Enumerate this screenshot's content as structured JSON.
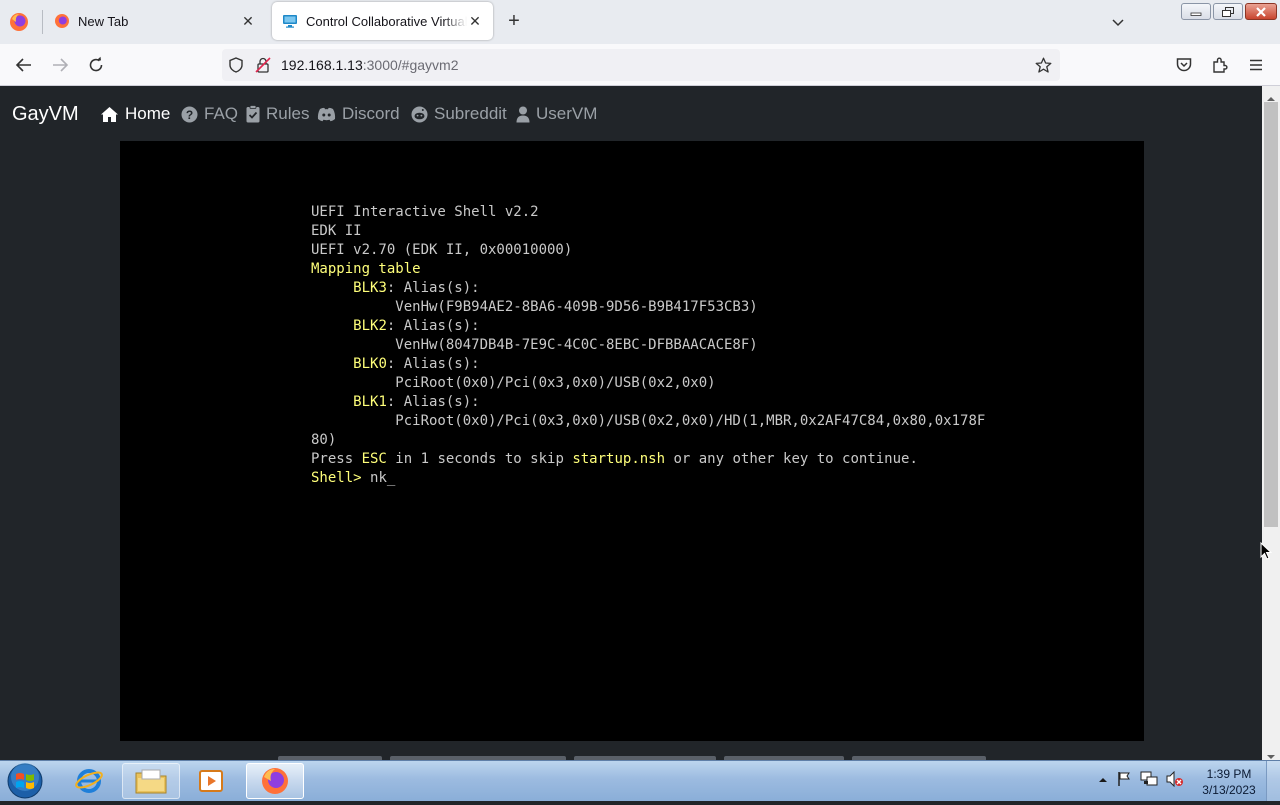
{
  "browser": {
    "tabs": [
      {
        "title": "New Tab",
        "active": false
      },
      {
        "title": "Control Collaborative Virtual Machines",
        "active": true
      }
    ],
    "url_host": "192.168.1.13",
    "url_rest": ":3000/#gayvm2"
  },
  "site": {
    "brand": "GayVM",
    "nav": {
      "home": "Home",
      "faq": "FAQ",
      "rules": "Rules",
      "discord": "Discord",
      "subreddit": "Subreddit",
      "uservm": "UserVM"
    }
  },
  "vm_console": {
    "lines": [
      {
        "text": "UEFI Interactive Shell v2.2"
      },
      {
        "text": "EDK II"
      },
      {
        "text": "UEFI v2.70 (EDK II, 0x00010000)"
      },
      {
        "highlight": "Mapping table"
      },
      {
        "indent": "     ",
        "highlight": "BLK3",
        "text": ": Alias(s):"
      },
      {
        "text": "          VenHw(F9B94AE2-8BA6-409B-9D56-B9B417F53CB3)"
      },
      {
        "indent": "     ",
        "highlight": "BLK2",
        "text": ": Alias(s):"
      },
      {
        "text": "          VenHw(8047DB4B-7E9C-4C0C-8EBC-DFBBAACACE8F)"
      },
      {
        "indent": "     ",
        "highlight": "BLK0",
        "text": ": Alias(s):"
      },
      {
        "text": "          PciRoot(0x0)/Pci(0x3,0x0)/USB(0x2,0x0)"
      },
      {
        "indent": "     ",
        "highlight": "BLK1",
        "text": ": Alias(s):"
      },
      {
        "text": "          PciRoot(0x0)/Pci(0x3,0x0)/USB(0x2,0x0)/HD(1,MBR,0x2AF47C84,0x80,0x178F"
      },
      {
        "text": "80)"
      },
      {
        "text": "Press ",
        "highlight": "ESC",
        "text2": " in 1 seconds to skip ",
        "highlight2": "startup.nsh",
        "text3": " or any other key to continue."
      },
      {
        "highlight": "Shell> ",
        "text": "nk",
        "cursor": "_"
      }
    ]
  },
  "taskbar": {
    "clock_time": "1:39 PM",
    "clock_date": "3/13/2023"
  },
  "colors": {
    "page_bg": "#212529",
    "console_text": "#c9c9c9",
    "console_highlight": "#ffff7a"
  }
}
